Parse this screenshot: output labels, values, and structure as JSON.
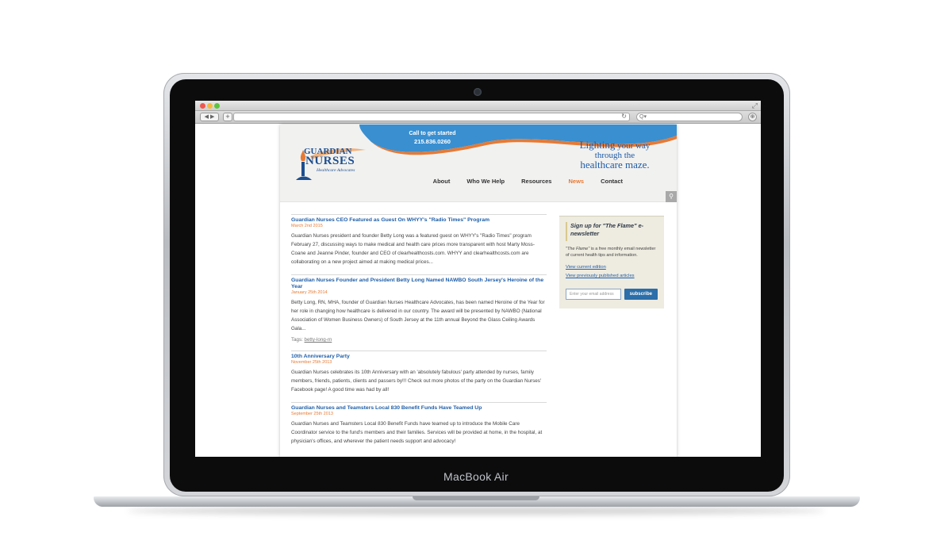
{
  "device": {
    "brand_label": "MacBook Air"
  },
  "browser": {
    "nav_arrows": "◀ ▶",
    "new_tab": "+",
    "search_placeholder": "Q▾",
    "download_icon": "⊕"
  },
  "site": {
    "call_line1": "Call to get started",
    "call_phone": "215.836.0260",
    "logo_line1": "GUARDIAN",
    "logo_line2": "NURSES",
    "logo_line3": "Healthcare Advocates",
    "tagline_a": "Lighting",
    "tagline_b": " your way",
    "tagline_c": "through the",
    "tagline_d": "healthcare maze.",
    "nav": [
      "About",
      "Who We Help",
      "Resources",
      "News",
      "Contact"
    ],
    "active_nav": "News",
    "colors": {
      "link_blue": "#1f5ea8",
      "accent_orange": "#e67a35",
      "swoosh_blue": "#3a8fd0"
    }
  },
  "articles": [
    {
      "title": "Guardian Nurses CEO Featured as Guest On WHYY's \"Radio Times\" Program",
      "date": "March 2nd 2015",
      "body": "Guardian Nurses president and founder Betty Long was a featured guest on WHYY's \"Radio Times\" program February 27, discussing ways to make medical and health care prices more transparent with host Marty Moss-Coane and Jeanne Pinder, founder and CEO of clearhealthcosts.com. WHYY and clearhealthcosts.com are collaborating on a new project aimed at making medical prices..."
    },
    {
      "title": "Guardian Nurses Founder and President Betty Long Named NAWBO South Jersey's Heroine of the Year",
      "date": "January 25th 2014",
      "body": "Betty Long, RN, MHA, founder of Guardian Nurses Healthcare Advocates, has been named Heroine of the Year for her role in changing how healthcare is delivered in our country. The award will be presented by NAWBO (National Association of Women Business Owners) of South Jersey at the 11th annual Beyond the Glass Ceiling Awards Gala...",
      "tags_label": "Tags:",
      "tags": "betty-long-rn"
    },
    {
      "title": "10th Anniversary Party",
      "date": "November 25th 2013",
      "body": "Guardian Nurses celebrates its 10th Anniversary with an 'absolutely fabulous' party attended by nurses, family members, friends, patients, clients and passers by!!!  Check out more photos of the party on the Guardian Nurses' Facebook page!  A good time was had by all!"
    },
    {
      "title": "Guardian Nurses and Teamsters Local 830 Benefit Funds Have Teamed Up",
      "date": "September 25th 2013",
      "body": "Guardian Nurses and Teamsters Local 830 Benefit Funds have teamed up to introduce the Mobile Care Coordinator service to the fund's members and their families.  Services will be provided at home, in the hospital, at physician's offices, and wherever the patient needs support and advocacy!"
    }
  ],
  "newsletter": {
    "title": "Sign up for \"The Flame\" e-newsletter",
    "desc_italic": "\"The Flame\"",
    "desc_rest": " is a free monthly email newsletter of current health tips and information.",
    "link1": "View current edition",
    "link2": "View previously published articles",
    "email_placeholder": "Enter your email address",
    "submit": "subscribe"
  }
}
